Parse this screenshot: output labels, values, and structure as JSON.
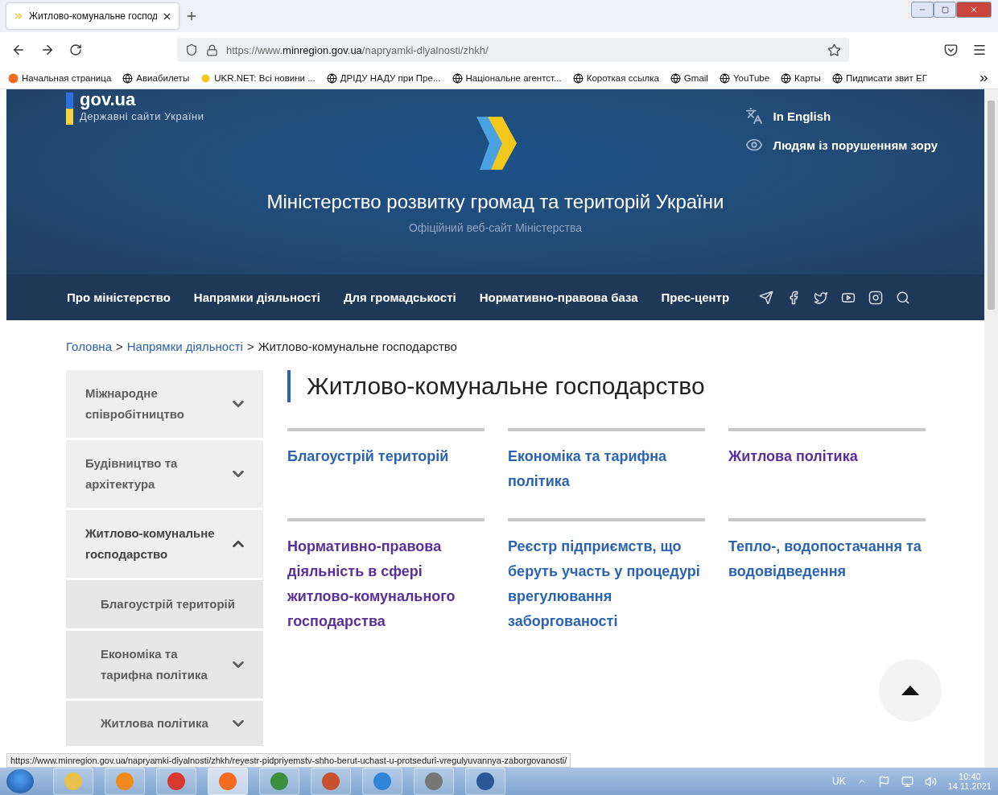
{
  "browser": {
    "tab": {
      "title": "Житлово-комунальне господ",
      "selected": true
    },
    "url": {
      "scheme": "https://www.",
      "domain": "minregion.gov.ua",
      "path": "/napryamki-diyalnosti/zhkh/"
    },
    "bookmarks": [
      {
        "label": "Начальная страница",
        "kind": "firefox"
      },
      {
        "label": "Авиабилеты",
        "kind": "globe"
      },
      {
        "label": "UKR.NET: Всі новини ...",
        "kind": "sun"
      },
      {
        "label": "ДРІДУ НАДУ при Пре...",
        "kind": "globe"
      },
      {
        "label": "Національне агентст...",
        "kind": "globe"
      },
      {
        "label": "Короткая ссылка",
        "kind": "globe"
      },
      {
        "label": "Gmail",
        "kind": "globe"
      },
      {
        "label": "YouTube",
        "kind": "globe"
      },
      {
        "label": "Карты",
        "kind": "globe"
      },
      {
        "label": "Пидписати звит ЕГ",
        "kind": "globe"
      }
    ],
    "status_url": "https://www.minregion.gov.ua/napryamki-diyalnosti/zhkh/reyestr-pidpriyemstv-shho-berut-uchast-u-protseduri-vregulyuvannya-zaborgovanosti/"
  },
  "header": {
    "gov_logo": "gov.ua",
    "gov_caption": "Державні сайти України",
    "english_link": "In English",
    "accessibility_link": "Людям із порушенням зору",
    "title": "Міністерство розвитку громад та територій України",
    "subtitle": "Офіційний веб-сайт Міністерства"
  },
  "nav": {
    "items": [
      "Про міністерство",
      "Напрямки діяльності",
      "Для громадськості",
      "Нормативно-правова база",
      "Прес-центр"
    ],
    "social": [
      {
        "kind": "telegram"
      },
      {
        "kind": "facebook"
      },
      {
        "kind": "twitter"
      },
      {
        "kind": "youtube"
      },
      {
        "kind": "instagram"
      },
      {
        "kind": "search"
      }
    ]
  },
  "breadcrumb": [
    {
      "kind": "link",
      "label": "Головна"
    },
    {
      "kind": "separator",
      "label": ">"
    },
    {
      "kind": "link",
      "label": "Напрямки діяльності"
    },
    {
      "kind": "separator",
      "label": ">"
    },
    {
      "kind": "current",
      "label": "Житлово-комунальне господарство"
    }
  ],
  "sidebar": {
    "items": [
      {
        "label": "Міжнародне співробітництво",
        "expanded": false,
        "sub": false
      },
      {
        "label": "Будівництво та архітектура",
        "expanded": false,
        "sub": false
      },
      {
        "label": "Житлово-комунальне господарство",
        "expanded": true,
        "sub": false
      },
      {
        "label": "Благоустрій територій",
        "sub": true
      },
      {
        "label": "Економіка та тарифна політика",
        "expanded": false,
        "sub": true
      },
      {
        "label": "Житлова політика",
        "expanded": false,
        "sub": true
      }
    ]
  },
  "page_title": "Житлово-комунальне господарство",
  "cards": [
    {
      "label": "Благоустрій територій",
      "visited": false
    },
    {
      "label": "Економіка та тарифна політика",
      "visited": false
    },
    {
      "label": "Житлова політика",
      "visited": true
    },
    {
      "label": "Нормативно-правова діяльність в сфері житлово-комунального господарства",
      "visited": true
    },
    {
      "label": "Реєстр підприємств, що беруть участь у процедурі врегулювання заборгованості",
      "visited": false
    },
    {
      "label": "Тепло-, водопостачання та водовідведення",
      "visited": false
    }
  ],
  "taskbar": {
    "apps": [
      {
        "kind": "folder",
        "active": false
      },
      {
        "kind": "media",
        "active": false
      },
      {
        "kind": "chrome",
        "active": false
      },
      {
        "kind": "firefox",
        "active": true
      },
      {
        "kind": "chrome2",
        "active": false
      },
      {
        "kind": "slides",
        "active": false
      },
      {
        "kind": "ie",
        "active": false
      },
      {
        "kind": "doc",
        "active": false
      },
      {
        "kind": "word",
        "active": false
      }
    ],
    "language": "UK",
    "time": "10:40",
    "date": "14.11.2021"
  }
}
